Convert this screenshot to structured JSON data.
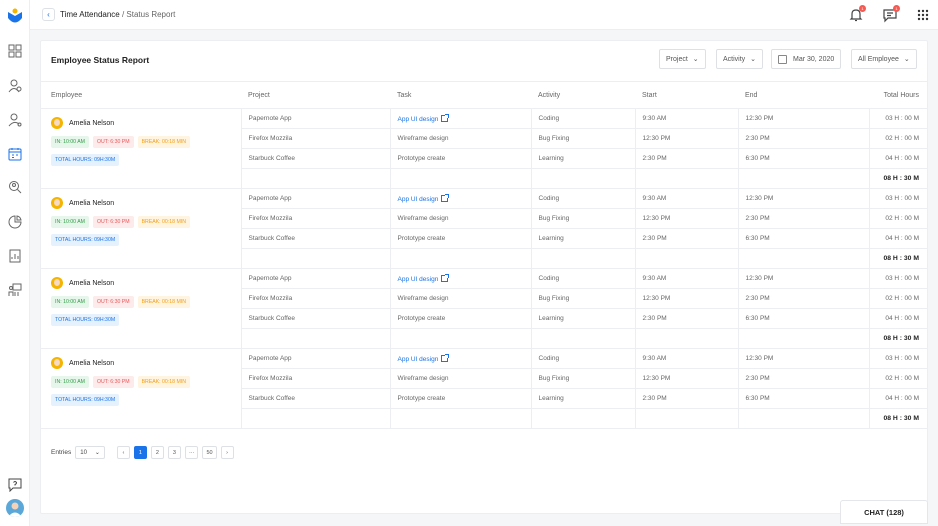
{
  "breadcrumb": {
    "section": "Time Attendance",
    "separator": " / ",
    "page": "Status Report"
  },
  "header": {
    "notifications_badge": "1",
    "messages_badge": "1"
  },
  "report": {
    "title": "Employee Status Report",
    "filters": {
      "project": "Project",
      "activity": "Activity",
      "date": "Mar 30, 2020",
      "employee": "All Employee"
    }
  },
  "table": {
    "columns": [
      "Employee",
      "Project",
      "Task",
      "Activity",
      "Start",
      "End",
      "Total Hours"
    ],
    "groups": [
      {
        "employee": {
          "name": "Amelia Nelson",
          "in": "IN: 10:00 AM",
          "out": "OUT: 6:30 PM",
          "break": "BREAK: 00:18 MIN",
          "total": "TOTAL HOURS: 09H:30M"
        },
        "rows": [
          {
            "project": "Papernote App",
            "task": "App UI design",
            "activity": "Coding",
            "start": "9:30 AM",
            "end": "12:30 PM",
            "total": "03 H : 00 M"
          },
          {
            "project": "Firefox Mozzila",
            "task": "Wireframe design",
            "activity": "Bug Fixing",
            "start": "12:30 PM",
            "end": "2:30 PM",
            "total": "02 H : 00 M"
          },
          {
            "project": "Starbuck Coffee",
            "task": "Prototype create",
            "activity": "Learning",
            "start": "2:30 PM",
            "end": "6:30 PM",
            "total": "04 H : 00 M"
          }
        ],
        "sum": "08 H : 30 M"
      },
      {
        "employee": {
          "name": "Amelia Nelson",
          "in": "IN: 10:00 AM",
          "out": "OUT: 6:30 PM",
          "break": "BREAK: 00:18 MIN",
          "total": "TOTAL HOURS: 09H:30M"
        },
        "rows": [
          {
            "project": "Papernote App",
            "task": "App UI design",
            "activity": "Coding",
            "start": "9:30 AM",
            "end": "12:30 PM",
            "total": "03 H : 00 M"
          },
          {
            "project": "Firefox Mozzila",
            "task": "Wireframe design",
            "activity": "Bug Fixing",
            "start": "12:30 PM",
            "end": "2:30 PM",
            "total": "02 H : 00 M"
          },
          {
            "project": "Starbuck Coffee",
            "task": "Prototype create",
            "activity": "Learning",
            "start": "2:30 PM",
            "end": "6:30 PM",
            "total": "04 H : 00 M"
          }
        ],
        "sum": "08 H : 30 M"
      },
      {
        "employee": {
          "name": "Amelia Nelson",
          "in": "IN: 10:00 AM",
          "out": "OUT: 6:30 PM",
          "break": "BREAK: 00:18 MIN",
          "total": "TOTAL HOURS: 09H:30M"
        },
        "rows": [
          {
            "project": "Papernote App",
            "task": "App UI design",
            "activity": "Coding",
            "start": "9:30 AM",
            "end": "12:30 PM",
            "total": "03 H : 00 M"
          },
          {
            "project": "Firefox Mozzila",
            "task": "Wireframe design",
            "activity": "Bug Fixing",
            "start": "12:30 PM",
            "end": "2:30 PM",
            "total": "02 H : 00 M"
          },
          {
            "project": "Starbuck Coffee",
            "task": "Prototype create",
            "activity": "Learning",
            "start": "2:30 PM",
            "end": "6:30 PM",
            "total": "04 H : 00 M"
          }
        ],
        "sum": "08 H : 30 M"
      },
      {
        "employee": {
          "name": "Amelia Nelson",
          "in": "IN: 10:00 AM",
          "out": "OUT: 6:30 PM",
          "break": "BREAK: 00:18 MIN",
          "total": "TOTAL HOURS: 09H:30M"
        },
        "rows": [
          {
            "project": "Papernote App",
            "task": "App UI design",
            "activity": "Coding",
            "start": "9:30 AM",
            "end": "12:30 PM",
            "total": "03 H : 00 M"
          },
          {
            "project": "Firefox Mozzila",
            "task": "Wireframe design",
            "activity": "Bug Fixing",
            "start": "12:30 PM",
            "end": "2:30 PM",
            "total": "02 H : 00 M"
          },
          {
            "project": "Starbuck Coffee",
            "task": "Prototype create",
            "activity": "Learning",
            "start": "2:30 PM",
            "end": "6:30 PM",
            "total": "04 H : 00 M"
          }
        ],
        "sum": "08 H : 30 M"
      }
    ]
  },
  "pagination": {
    "label": "Entries",
    "per_page": "10",
    "pages": [
      "1",
      "2",
      "3",
      "···",
      "50"
    ],
    "active": "1"
  },
  "chat": {
    "label": "CHAT (128)"
  },
  "colors": {
    "accent": "#1a73e8",
    "in": "#2e9e47",
    "out": "#e35b5b",
    "break": "#f29e15"
  }
}
